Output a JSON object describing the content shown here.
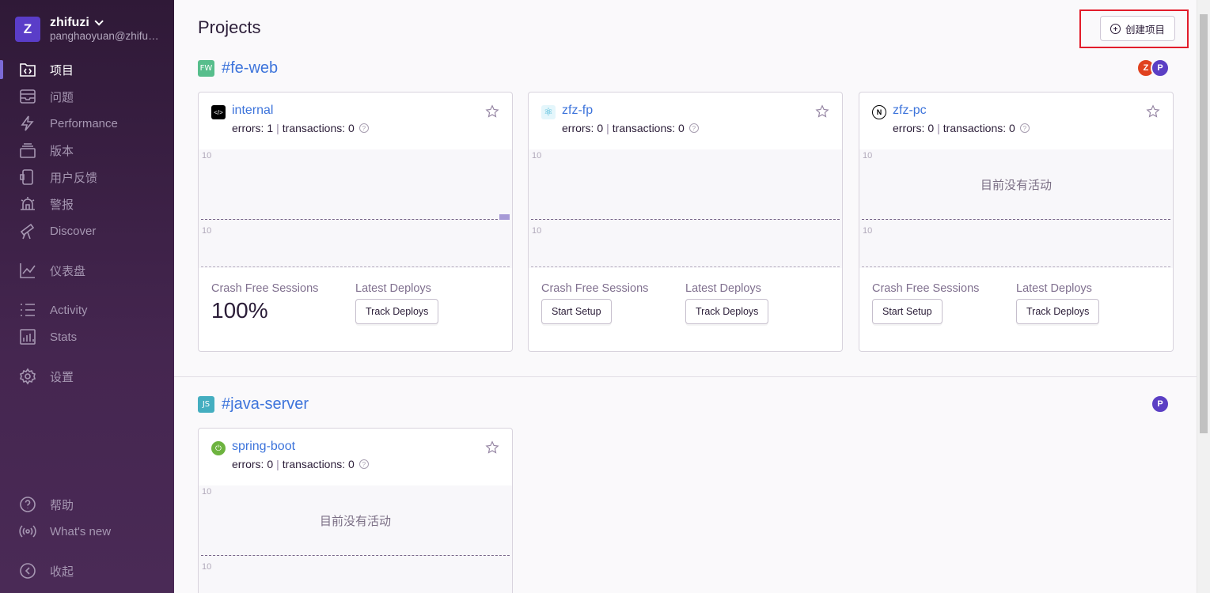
{
  "org": {
    "avatar_letter": "Z",
    "name": "zhifuzi",
    "email": "panghaoyuan@zhifuzi.com"
  },
  "nav": {
    "projects": "项目",
    "issues": "问题",
    "performance": "Performance",
    "releases": "版本",
    "feedback": "用户反馈",
    "alerts": "警报",
    "discover": "Discover",
    "dashboards": "仪表盘",
    "activity": "Activity",
    "stats": "Stats",
    "settings": "设置",
    "help": "帮助",
    "whats_new": "What's new",
    "collapse": "收起"
  },
  "page": {
    "title": "Projects",
    "create_button": "创建项目"
  },
  "teams": [
    {
      "badge": "FW",
      "badge_color": "#57be8c",
      "name": "#fe-web",
      "avatars": [
        {
          "letter": "Z",
          "color": "#e0421f"
        },
        {
          "letter": "P",
          "color": "#5b3fc4"
        }
      ],
      "projects": [
        {
          "name": "internal",
          "errors": "errors: 1",
          "transactions": "transactions: 0",
          "tick_top": "10",
          "tick_bottom": "10",
          "empty_text": "",
          "crash_label": "Crash Free Sessions",
          "crash_value": "100%",
          "deploys_label": "Latest Deploys",
          "deploys_button": "Track Deploys"
        },
        {
          "name": "zfz-fp",
          "errors": "errors: 0",
          "transactions": "transactions: 0",
          "tick_top": "10",
          "tick_bottom": "10",
          "empty_text": "",
          "crash_label": "Crash Free Sessions",
          "crash_button": "Start Setup",
          "deploys_label": "Latest Deploys",
          "deploys_button": "Track Deploys"
        },
        {
          "name": "zfz-pc",
          "errors": "errors: 0",
          "transactions": "transactions: 0",
          "tick_top": "10",
          "tick_bottom": "10",
          "empty_text": "目前没有活动",
          "crash_label": "Crash Free Sessions",
          "crash_button": "Start Setup",
          "deploys_label": "Latest Deploys",
          "deploys_button": "Track Deploys"
        }
      ]
    },
    {
      "badge": "JS",
      "badge_color": "#44aec0",
      "name": "#java-server",
      "avatars": [
        {
          "letter": "P",
          "color": "#5b3fc4"
        }
      ],
      "projects": [
        {
          "name": "spring-boot",
          "errors": "errors: 0",
          "transactions": "transactions: 0",
          "tick_top": "10",
          "tick_bottom": "10",
          "empty_text": "目前没有活动"
        }
      ]
    }
  ]
}
